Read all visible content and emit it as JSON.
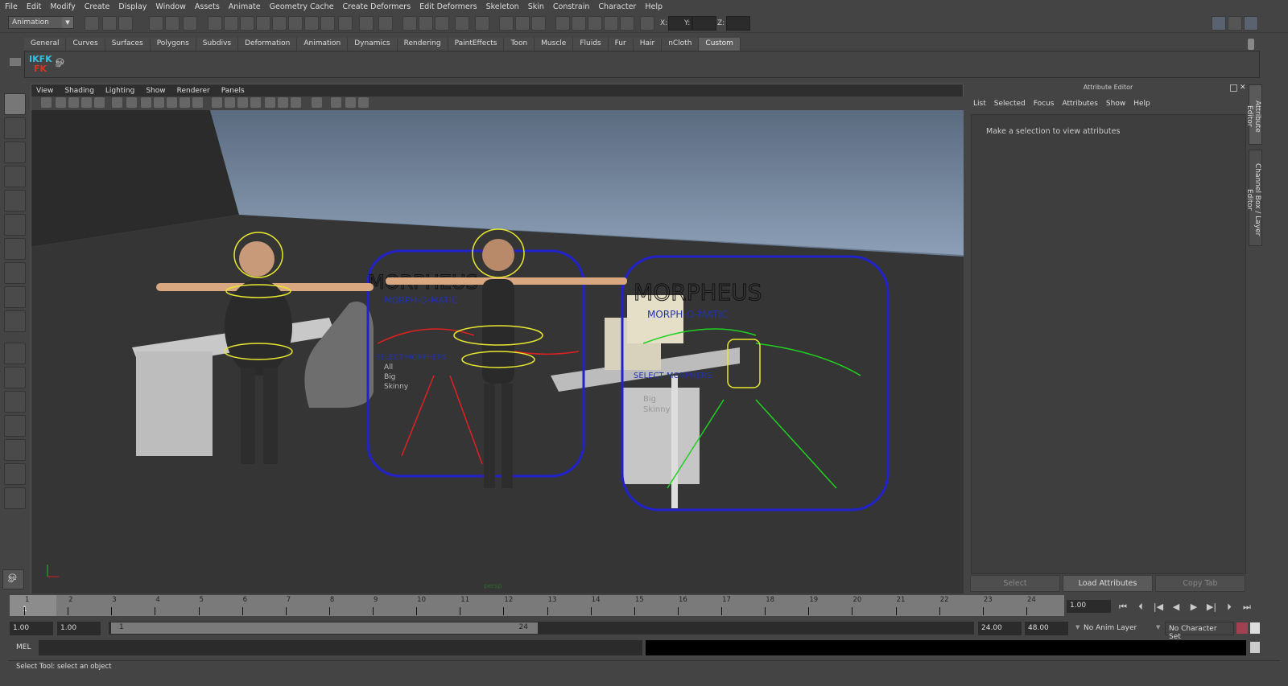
{
  "menu": [
    "File",
    "Edit",
    "Modify",
    "Create",
    "Display",
    "Window",
    "Assets",
    "Animate",
    "Geometry Cache",
    "Create Deformers",
    "Edit Deformers",
    "Skeleton",
    "Skin",
    "Constrain",
    "Character",
    "Help"
  ],
  "status": {
    "mode": "Animation",
    "x_label": "X:",
    "y_label": "Y:",
    "z_label": "Z:",
    "x": "",
    "y": "",
    "z": ""
  },
  "shelf": {
    "tabs": [
      "General",
      "Curves",
      "Surfaces",
      "Polygons",
      "Subdivs",
      "Deformation",
      "Animation",
      "Dynamics",
      "Rendering",
      "PaintEffects",
      "Toon",
      "Muscle",
      "Fluids",
      "Fur",
      "Hair",
      "nCloth",
      "Custom"
    ],
    "active": "Custom",
    "items": [
      {
        "icon": "ik-fk-icon",
        "label": "IKFK"
      },
      {
        "icon": "script-icon"
      }
    ]
  },
  "viewport": {
    "menu": [
      "View",
      "Shading",
      "Lighting",
      "Show",
      "Renderer",
      "Panels"
    ],
    "camera": "persp",
    "scene_text": {
      "logo": "MORPHEUS",
      "sub": "MORPH-O-MATIC",
      "select": "SELECT MORPHERS",
      "opts_left": [
        "All",
        "Big",
        "Skinny"
      ],
      "opts_right": [
        "Big",
        "Skinny"
      ]
    },
    "colors": {
      "sky_top": "#5a6b80",
      "sky_bottom": "#8c9fb6",
      "wall": "#2b2b2b",
      "floor": "#353535",
      "panel_border": "#2222cc",
      "rig_yellow": "#e8e830",
      "rig_red": "#e02020",
      "rig_green": "#20d020"
    }
  },
  "attribute_editor": {
    "title": "Attribute Editor",
    "menu": [
      "List",
      "Selected",
      "Focus",
      "Attributes",
      "Show",
      "Help"
    ],
    "message": "Make a selection to view attributes",
    "buttons": {
      "select": "Select",
      "load": "Load Attributes",
      "copy": "Copy Tab"
    },
    "side_tabs": [
      "Attribute Editor",
      "Channel Box / Layer Editor"
    ]
  },
  "timeline": {
    "frames": [
      1,
      2,
      3,
      4,
      5,
      6,
      7,
      8,
      9,
      10,
      11,
      12,
      13,
      14,
      15,
      16,
      17,
      18,
      19,
      20,
      21,
      22,
      23,
      24
    ],
    "current_marker": "1",
    "current_frame": "1.00"
  },
  "range": {
    "start_time": "1.00",
    "playback_start": "1.00",
    "bar_start": "1",
    "bar_end": "24",
    "playback_end": "24.00",
    "end_time": "48.00",
    "anim_layer": "No Anim Layer",
    "character_set": "No Character Set"
  },
  "mel": {
    "label": "MEL",
    "command": "",
    "result": ""
  },
  "help_line": "Select Tool: select an object"
}
